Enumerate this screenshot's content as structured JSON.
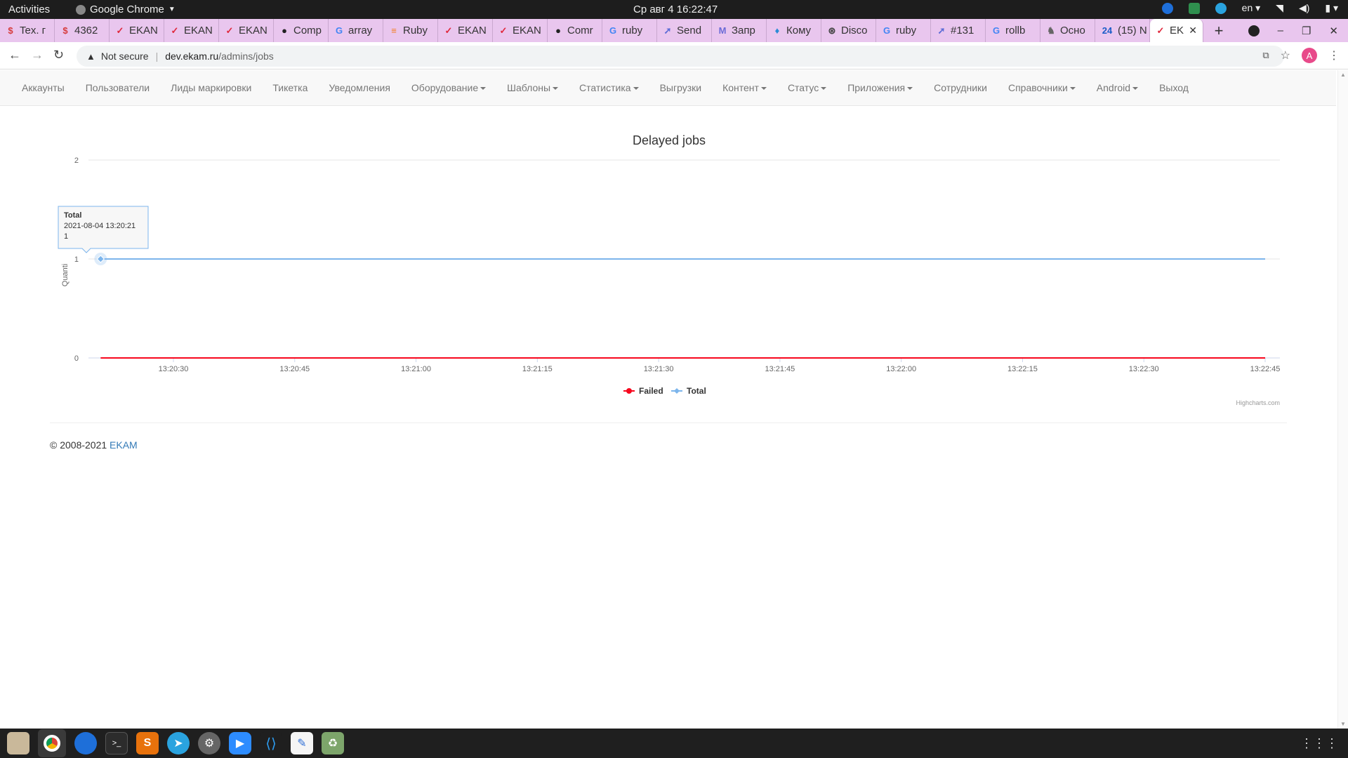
{
  "system": {
    "activities": "Activities",
    "app_name": "Google Chrome",
    "clock": "Ср авг 4  16:22:47",
    "lang": "en"
  },
  "tabs": [
    {
      "label": "Tex. г",
      "icon": "s-icon",
      "color": "#d63b3b"
    },
    {
      "label": "4362",
      "icon": "s-icon",
      "color": "#d63b3b"
    },
    {
      "label": "EKAN",
      "icon": "check-icon",
      "color": "#e0283c"
    },
    {
      "label": "EKAN",
      "icon": "check-icon",
      "color": "#e0283c"
    },
    {
      "label": "EKAN",
      "icon": "check-icon",
      "color": "#e0283c"
    },
    {
      "label": "Comp",
      "icon": "github-icon",
      "color": "#222222"
    },
    {
      "label": "array",
      "icon": "google-icon",
      "color": "#4285f4"
    },
    {
      "label": "Ruby",
      "icon": "stack-icon",
      "color": "#f48024"
    },
    {
      "label": "EKAN",
      "icon": "check-icon",
      "color": "#e0283c"
    },
    {
      "label": "EKAN",
      "icon": "check-icon",
      "color": "#e0283c"
    },
    {
      "label": "Comr",
      "icon": "github-icon",
      "color": "#222222"
    },
    {
      "label": "ruby",
      "icon": "google-icon",
      "color": "#4285f4"
    },
    {
      "label": "Send",
      "icon": "send-icon",
      "color": "#5b6bd6"
    },
    {
      "label": "Запр",
      "icon": "mail-icon",
      "color": "#6b6bd6"
    },
    {
      "label": "Кому",
      "icon": "drops-icon",
      "color": "#2a8bd6"
    },
    {
      "label": "Disco",
      "icon": "ball-icon",
      "color": "#444444"
    },
    {
      "label": "ruby",
      "icon": "google-icon",
      "color": "#4285f4"
    },
    {
      "label": "#131",
      "icon": "send-icon",
      "color": "#5b6bd6"
    },
    {
      "label": "rollb",
      "icon": "google-icon",
      "color": "#4285f4"
    },
    {
      "label": "Осно",
      "icon": "horse-icon",
      "color": "#666666"
    },
    {
      "label": "(15) N",
      "icon": "num-icon",
      "badge": "24",
      "color": "#1a5cc8"
    },
    {
      "label": "EK",
      "icon": "check-icon",
      "color": "#e0283c",
      "active": true
    }
  ],
  "address": {
    "security": "Not secure",
    "host": "dev.ekam.ru",
    "path": "/admins/jobs",
    "avatar_letter": "A"
  },
  "nav": [
    {
      "label": "Аккаунты",
      "dropdown": false
    },
    {
      "label": "Пользователи",
      "dropdown": false
    },
    {
      "label": "Лиды маркировки",
      "dropdown": false
    },
    {
      "label": "Тикетка",
      "dropdown": false
    },
    {
      "label": "Уведомления",
      "dropdown": false
    },
    {
      "label": "Оборудование",
      "dropdown": true
    },
    {
      "label": "Шаблоны",
      "dropdown": true
    },
    {
      "label": "Статистика",
      "dropdown": true
    },
    {
      "label": "Выгрузки",
      "dropdown": false
    },
    {
      "label": "Контент",
      "dropdown": true
    },
    {
      "label": "Статус",
      "dropdown": true
    },
    {
      "label": "Приложения",
      "dropdown": true
    },
    {
      "label": "Сотрудники",
      "dropdown": false
    },
    {
      "label": "Справочники",
      "dropdown": true
    },
    {
      "label": "Android",
      "dropdown": true
    },
    {
      "label": "Выход",
      "dropdown": false
    }
  ],
  "chart_data": {
    "type": "line",
    "title": "Delayed jobs",
    "ylabel": "Quanti",
    "ylim": [
      0,
      2
    ],
    "yticks": [
      "0",
      "1",
      "2"
    ],
    "xticks": [
      "13:20:30",
      "13:20:45",
      "13:21:00",
      "13:21:15",
      "13:21:30",
      "13:21:45",
      "13:22:00",
      "13:22:15",
      "13:22:30",
      "13:22:45"
    ],
    "x_start": "13:20:21",
    "x_end": "13:22:45",
    "series": [
      {
        "name": "Failed",
        "color": "#f7071d",
        "x": [
          "13:20:21",
          "13:22:45"
        ],
        "values": [
          0,
          0
        ]
      },
      {
        "name": "Total",
        "color": "#7cb5ec",
        "x": [
          "13:20:21",
          "13:22:45"
        ],
        "values": [
          1,
          1
        ]
      }
    ],
    "legend_position": "bottom-center",
    "tooltip": {
      "series": "Total",
      "date": "2021-08-04 13:20:21",
      "value": "1"
    },
    "credits": "Highcharts.com",
    "grid": true
  },
  "footer": {
    "copyright": "© 2008-2021",
    "link": "EKAM"
  }
}
